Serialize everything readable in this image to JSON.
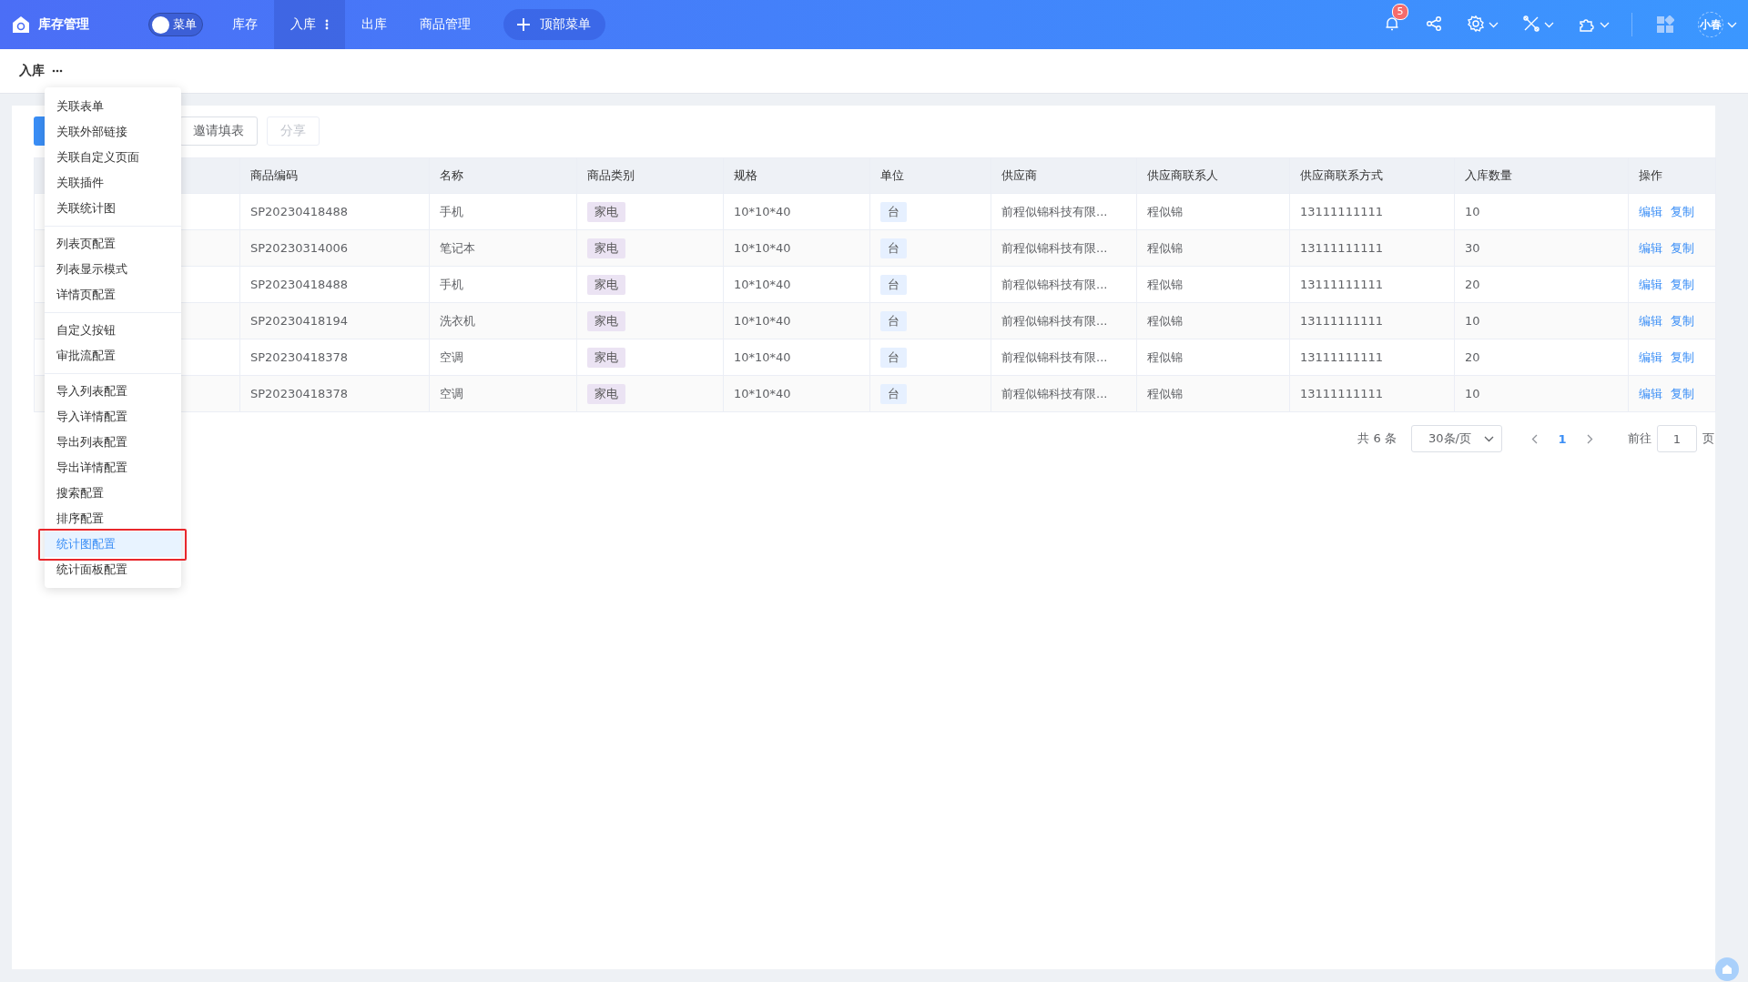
{
  "header": {
    "app_title": "库存管理",
    "menu_toggle": {
      "label": "菜单",
      "on": false
    },
    "nav": [
      {
        "label": "库存",
        "selected": false,
        "has_more": false
      },
      {
        "label": "入库",
        "selected": true,
        "has_more": true
      },
      {
        "label": "出库",
        "selected": false,
        "has_more": false
      },
      {
        "label": "商品管理",
        "selected": false,
        "has_more": false
      }
    ],
    "top_menu_button": "顶部菜单",
    "notification_count": "5",
    "user": "小春"
  },
  "breadcrumb": {
    "title": "入库"
  },
  "toolbar": {
    "buttons": [
      {
        "label": "邀请填表",
        "disabled": false
      },
      {
        "label": "分享",
        "disabled": true
      }
    ]
  },
  "table": {
    "columns": [
      "商品编码",
      "名称",
      "商品类别",
      "规格",
      "单位",
      "供应商",
      "供应商联系人",
      "供应商联系方式",
      "入库数量",
      "操作"
    ],
    "rows": [
      {
        "code": "SP20230418488",
        "name": "手机",
        "category": "家电",
        "spec": "10*10*40",
        "unit": "台",
        "supplier": "前程似锦科技有限...",
        "contact": "程似锦",
        "phone": "13111111111",
        "quantity": "10",
        "actions": [
          "编辑",
          "复制"
        ]
      },
      {
        "code": "SP20230314006",
        "name": "笔记本",
        "category": "家电",
        "spec": "10*10*40",
        "unit": "台",
        "supplier": "前程似锦科技有限...",
        "contact": "程似锦",
        "phone": "13111111111",
        "quantity": "30",
        "actions": [
          "编辑",
          "复制"
        ]
      },
      {
        "code": "SP20230418488",
        "name": "手机",
        "category": "家电",
        "spec": "10*10*40",
        "unit": "台",
        "supplier": "前程似锦科技有限...",
        "contact": "程似锦",
        "phone": "13111111111",
        "quantity": "20",
        "actions": [
          "编辑",
          "复制"
        ]
      },
      {
        "code": "SP20230418194",
        "name": "洗衣机",
        "category": "家电",
        "spec": "10*10*40",
        "unit": "台",
        "supplier": "前程似锦科技有限...",
        "contact": "程似锦",
        "phone": "13111111111",
        "quantity": "10",
        "actions": [
          "编辑",
          "复制"
        ]
      },
      {
        "code": "SP20230418378",
        "name": "空调",
        "category": "家电",
        "spec": "10*10*40",
        "unit": "台",
        "supplier": "前程似锦科技有限...",
        "contact": "程似锦",
        "phone": "13111111111",
        "quantity": "20",
        "actions": [
          "编辑",
          "复制"
        ]
      },
      {
        "code": "SP20230418378",
        "name": "空调",
        "category": "家电",
        "spec": "10*10*40",
        "unit": "台",
        "supplier": "前程似锦科技有限...",
        "contact": "程似锦",
        "phone": "13111111111",
        "quantity": "10",
        "actions": [
          "编辑",
          "复制"
        ]
      }
    ]
  },
  "pagination": {
    "total": "共 6 条",
    "page_size": "30条/页",
    "pages": [
      {
        "label": "1",
        "selected": true
      }
    ],
    "goto_label": "前往",
    "goto_value": "1",
    "page_suffix": "页"
  },
  "dropdown_menu": {
    "groups": [
      [
        {
          "label": "关联表单",
          "selected": false
        },
        {
          "label": "关联外部链接",
          "selected": false
        },
        {
          "label": "关联自定义页面",
          "selected": false
        },
        {
          "label": "关联插件",
          "selected": false
        },
        {
          "label": "关联统计图",
          "selected": false
        }
      ],
      [
        {
          "label": "列表页配置",
          "selected": false
        },
        {
          "label": "列表显示模式",
          "selected": false
        },
        {
          "label": "详情页配置",
          "selected": false
        }
      ],
      [
        {
          "label": "自定义按钮",
          "selected": false
        },
        {
          "label": "审批流配置",
          "selected": false
        }
      ],
      [
        {
          "label": "导入列表配置",
          "selected": false
        },
        {
          "label": "导入详情配置",
          "selected": false
        },
        {
          "label": "导出列表配置",
          "selected": false
        },
        {
          "label": "导出详情配置",
          "selected": false
        },
        {
          "label": "搜索配置",
          "selected": false
        },
        {
          "label": "排序配置",
          "selected": false
        },
        {
          "label": "统计图配置",
          "selected": true
        },
        {
          "label": "统计面板配置",
          "selected": false
        }
      ]
    ]
  }
}
